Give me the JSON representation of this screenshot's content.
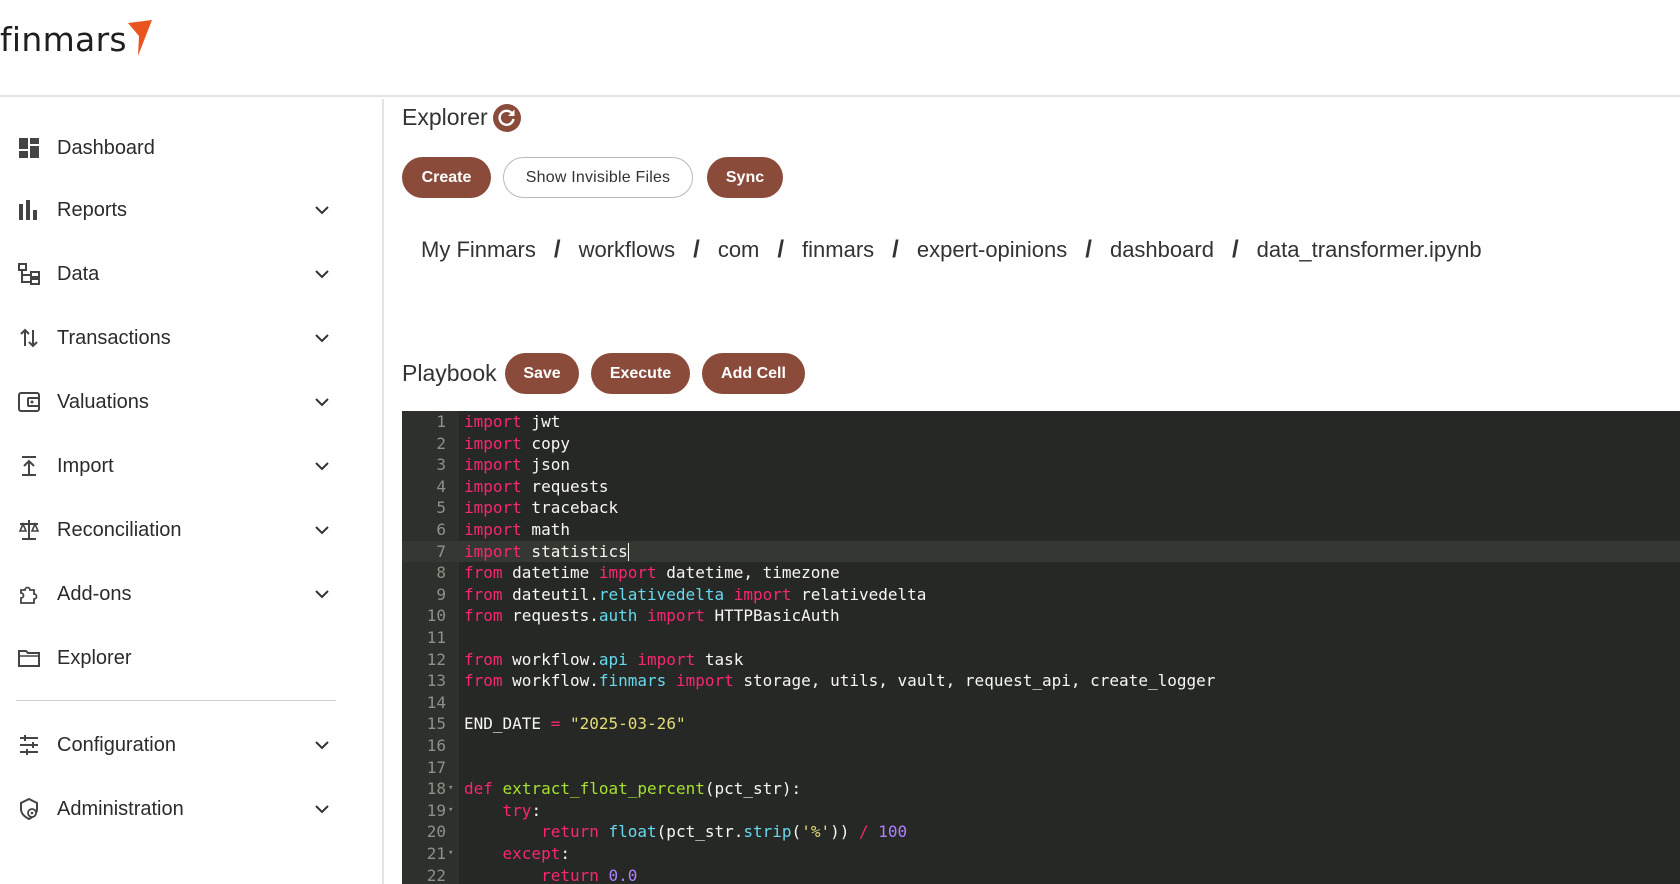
{
  "app": {
    "logo_text": "finmars",
    "brand_color": "#8a4b3b",
    "accent_color": "#e8551f"
  },
  "sidebar": {
    "items": [
      {
        "label": "Dashboard",
        "icon": "dashboard-icon",
        "expandable": false
      },
      {
        "label": "Reports",
        "icon": "bar-chart-icon",
        "expandable": true
      },
      {
        "label": "Data",
        "icon": "data-tree-icon",
        "expandable": true
      },
      {
        "label": "Transactions",
        "icon": "swap-vertical-icon",
        "expandable": true
      },
      {
        "label": "Valuations",
        "icon": "wallet-icon",
        "expandable": true
      },
      {
        "label": "Import",
        "icon": "upload-icon",
        "expandable": true
      },
      {
        "label": "Reconciliation",
        "icon": "scale-icon",
        "expandable": true
      },
      {
        "label": "Add-ons",
        "icon": "puzzle-icon",
        "expandable": true
      },
      {
        "label": "Explorer",
        "icon": "folder-icon",
        "expandable": false
      },
      {
        "label": "Configuration",
        "icon": "sliders-icon",
        "expandable": true
      },
      {
        "label": "Administration",
        "icon": "admin-gear-icon",
        "expandable": true
      }
    ]
  },
  "explorer": {
    "title": "Explorer",
    "buttons": {
      "create": "Create",
      "show_invisible": "Show Invisible Files",
      "sync": "Sync"
    },
    "breadcrumb": [
      "My Finmars",
      "workflows",
      "com",
      "finmars",
      "expert-opinions",
      "dashboard",
      "data_transformer.ipynb"
    ],
    "separator": "/"
  },
  "playbook": {
    "title": "Playbook",
    "buttons": {
      "save": "Save",
      "execute": "Execute",
      "add_cell": "Add Cell"
    },
    "active_line": 7,
    "lines": [
      "import jwt",
      "import copy",
      "import json",
      "import requests",
      "import traceback",
      "import math",
      "import statistics",
      "from datetime import datetime, timezone",
      "from dateutil.relativedelta import relativedelta",
      "from requests.auth import HTTPBasicAuth",
      "",
      "from workflow.api import task",
      "from workflow.finmars import storage, utils, vault, request_api, create_logger",
      "",
      "END_DATE = \"2025-03-26\"",
      "",
      "",
      "def extract_float_percent(pct_str):",
      "    try:",
      "        return float(pct_str.strip('%')) / 100",
      "    except:",
      "        return 0.0"
    ],
    "fold_lines": [
      18,
      19,
      21
    ]
  }
}
